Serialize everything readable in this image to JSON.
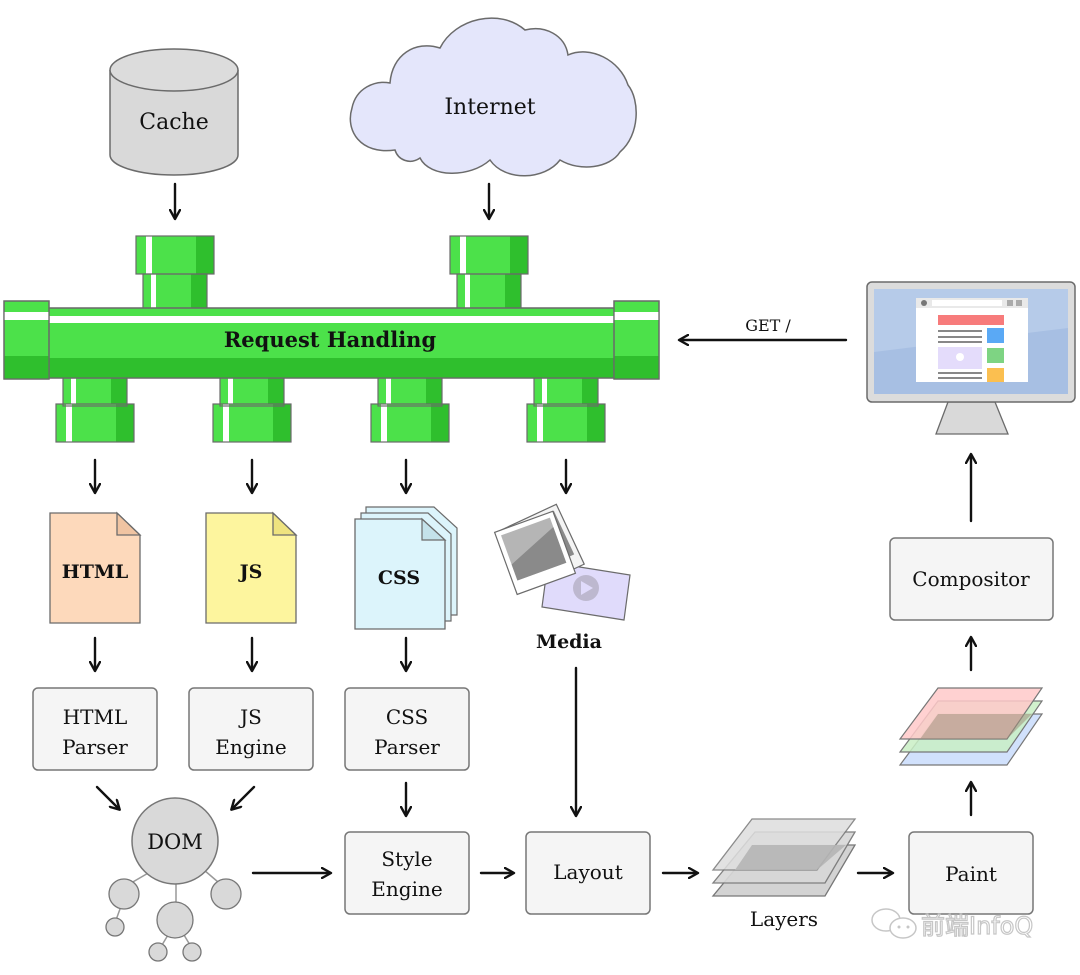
{
  "sources": {
    "cache": {
      "label": "Cache",
      "color": "#d9d9d9"
    },
    "internet": {
      "label": "Internet",
      "color": "#e4e6fb"
    }
  },
  "request_handling": {
    "label": "Request Handling",
    "pipe_color": "#4ce14a",
    "pipe_shade": "#2fbf2d"
  },
  "request_label": "GET /",
  "resources": {
    "html": {
      "label": "HTML",
      "color": "#fdd9bb"
    },
    "js": {
      "label": "JS",
      "color": "#fdf59e"
    },
    "css": {
      "label": "CSS",
      "color": "#dcf4fb"
    },
    "media": {
      "label": "Media",
      "color": "#e0dbfb"
    }
  },
  "processors": {
    "html_parser": {
      "line1": "HTML",
      "line2": "Parser"
    },
    "js_engine": {
      "line1": "JS",
      "line2": "Engine"
    },
    "css_parser": {
      "line1": "CSS",
      "line2": "Parser"
    }
  },
  "dom": {
    "label": "DOM"
  },
  "pipeline": {
    "style_engine": {
      "line1": "Style",
      "line2": "Engine"
    },
    "layout": {
      "label": "Layout"
    },
    "layers": {
      "label": "Layers"
    },
    "paint": {
      "label": "Paint"
    },
    "compositor": {
      "label": "Compositor"
    }
  },
  "paint_layer_colors": [
    "#ffc9c9",
    "#c9efc4",
    "#c9dcfb"
  ],
  "watermark": "前端InfoQ"
}
